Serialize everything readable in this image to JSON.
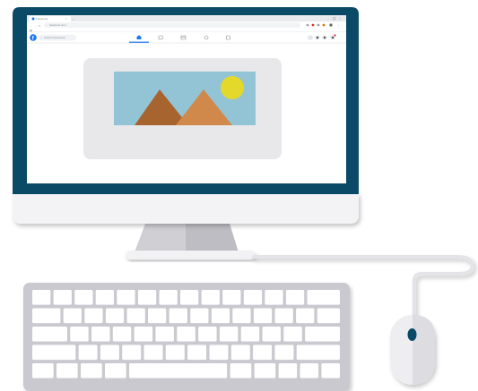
{
  "browser": {
    "tab_title": "Facebook",
    "address": "facebook.com",
    "search_placeholder": "Search Facebook",
    "nav_icons": [
      "home-icon",
      "watch-icon",
      "marketplace-icon",
      "groups-icon",
      "gaming-icon"
    ],
    "action_icons": [
      "menu-icon",
      "messenger-icon",
      "notifications-icon",
      "account-icon"
    ]
  },
  "content": {
    "image_placeholder_icon": "landscape-image-icon"
  },
  "colors": {
    "monitor_bezel": "#0b4a66",
    "facebook_blue": "#1877f2",
    "sky": "#93c4d6",
    "sun": "#e4d82a",
    "mountain_dark": "#a8642f",
    "mountain_light": "#d0894a",
    "card_gray": "#e8e8ea",
    "keyboard_gray": "#c9c9cf",
    "mouse_wheel": "#0b4a66"
  }
}
